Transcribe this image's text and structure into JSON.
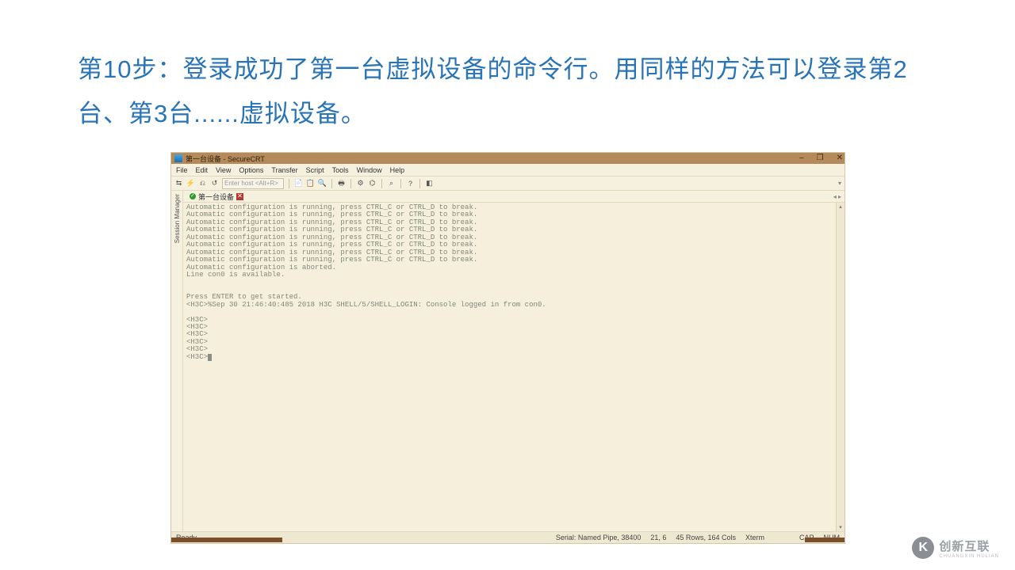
{
  "heading": "第10步：登录成功了第一台虚拟设备的命令行。用同样的方法可以登录第2台、第3台......虚拟设备。",
  "app": {
    "title": "第一台设备 - SecureCRT",
    "minimize": "–",
    "maximize": "❐",
    "close": "✕"
  },
  "menu": {
    "file": "File",
    "edit": "Edit",
    "view": "View",
    "options": "Options",
    "transfer": "Transfer",
    "script": "Script",
    "tools": "Tools",
    "window": "Window",
    "help": "Help"
  },
  "toolbar": {
    "host_placeholder": "Enter host <Alt+R>"
  },
  "session_manager_label": "Session Manager",
  "tab": {
    "name": "第一台设备",
    "close": "✕",
    "nav": "◂ ▸"
  },
  "terminal_lines": "Automatic configuration is running, press CTRL_C or CTRL_D to break.\nAutomatic configuration is running, press CTRL_C or CTRL_D to break.\nAutomatic configuration is running, press CTRL_C or CTRL_D to break.\nAutomatic configuration is running, press CTRL_C or CTRL_D to break.\nAutomatic configuration is running, press CTRL_C or CTRL_D to break.\nAutomatic configuration is running, press CTRL_C or CTRL_D to break.\nAutomatic configuration is running, press CTRL_C or CTRL_D to break.\nAutomatic configuration is running, press CTRL_C or CTRL_D to break.\nAutomatic configuration is aborted.\nLine con0 is available.\n\n\nPress ENTER to get started.\n<H3C>%Sep 30 21:46:40:485 2018 H3C SHELL/5/SHELL_LOGIN: Console logged in from con0.\n\n<H3C>\n<H3C>\n<H3C>\n<H3C>\n<H3C>\n<H3C>",
  "status": {
    "ready": "Ready",
    "conn": "Serial: Named Pipe, 38400",
    "pos": "21,  6",
    "size": "45 Rows, 164 Cols",
    "term": "Xterm",
    "cap": "CAP",
    "num": "NUM"
  },
  "watermark": {
    "logo": "K",
    "brand": "创新互联",
    "sub": "CHUANGXIN HULIAN"
  }
}
